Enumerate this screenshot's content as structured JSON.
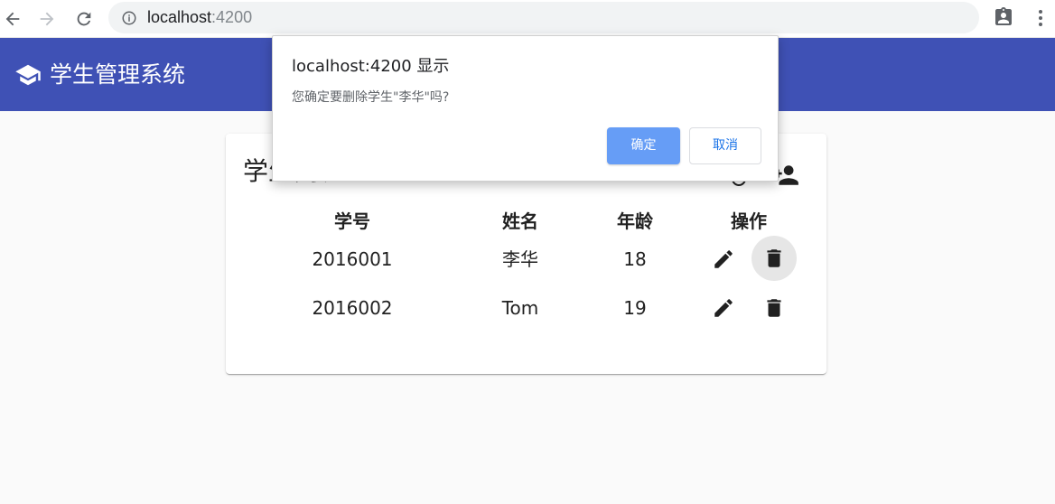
{
  "browser": {
    "url_host": "localhost",
    "url_port": ":4200"
  },
  "toolbar": {
    "title": "学生管理系统",
    "icon": "school-icon",
    "color": "#3f51b5"
  },
  "card": {
    "title": "学生列表",
    "columns": [
      "学号",
      "姓名",
      "年龄",
      "操作"
    ],
    "rows": [
      {
        "id": "2016001",
        "name": "李华",
        "age": "18"
      },
      {
        "id": "2016002",
        "name": "Tom",
        "age": "19"
      }
    ]
  },
  "dialog": {
    "title": "localhost:4200 显示",
    "message": "您确定要删除学生\"李华\"吗?",
    "ok_label": "确定",
    "cancel_label": "取消"
  }
}
